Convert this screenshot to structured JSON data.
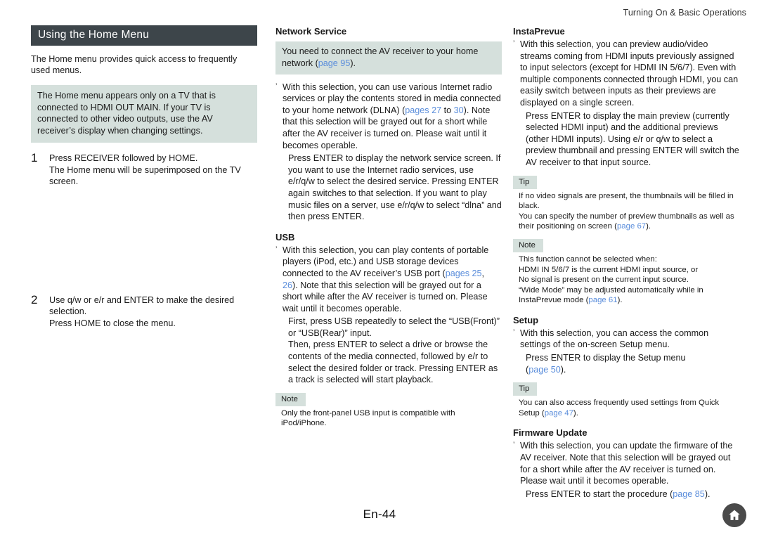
{
  "running_head": "Turning On & Basic Operations",
  "folio": "En-44",
  "home_button": {
    "icon": "home-icon"
  },
  "colors": {
    "title_bar_bg": "#3d454a",
    "callout_bg": "#d5e0dc",
    "link": "#5a8ddb",
    "text": "#1a1a1a",
    "home_button_bg": "#4a4a4a"
  },
  "left_column": {
    "title": "Using the Home Menu",
    "intro": "The Home menu provides quick access to frequently used menus.",
    "callout": "The Home menu appears only on a TV that is connected to HDMI OUT MAIN. If your TV is connected to other video outputs, use the AV receiver’s display when changing settings.",
    "steps": [
      {
        "number": "1",
        "body": "Press RECEIVER followed by HOME.",
        "sub": "The Home menu will be superimposed on the TV screen."
      },
      {
        "number": "2",
        "body": "Use q/w or e/r and ENTER to make the desired selection.",
        "sub": "Press HOME to close the menu."
      }
    ]
  },
  "middle_column": {
    "network_service": {
      "heading": "Network Service",
      "callout_pre": "You need to connect the AV receiver to your home network (",
      "callout_link": "page 95",
      "callout_post": ").",
      "bullet_1": "With this selection, you can use various Internet radio services or play the contents stored in media connected to your home network (DLNA) (",
      "bullet_1_link_a": "pages 27",
      "bullet_1_mid": " to ",
      "bullet_1_link_b": "30",
      "bullet_1_post": "). Note that this selection will be grayed out for a short while after the AV receiver is turned on. Please wait until it becomes operable.",
      "detail_1": "Press ENTER to display the network service screen. If you want to use the Internet radio services, use e/r/q/w to select the desired service. Pressing ENTER again switches to that selection. If you want to play music files on a server, use e/r/q/w to select “dlna” and then press ENTER."
    },
    "usb": {
      "heading": "USB",
      "bullet_1": "With this selection, you can play contents of portable players (iPod, etc.) and USB storage devices connected to the AV receiver’s USB port (",
      "bullet_1_link_a": "pages 25",
      "bullet_1_mid": ", ",
      "bullet_1_link_b": "26",
      "bullet_1_post": "). Note that this selection will be grayed out for a short while after the AV receiver is turned on. Please wait until it becomes operable.",
      "detail_1": "First, press USB repeatedly to select the “USB(Front)” or “USB(Rear)” input.",
      "detail_2": "Then, press ENTER to select a drive or browse the contents of the media connected, followed by e/r to select the desired folder or track. Pressing ENTER as a track is selected will start playback.",
      "note": {
        "tag": "Note",
        "lines": [
          "Only the front-panel USB input is compatible with iPod/iPhone."
        ]
      }
    }
  },
  "right_column": {
    "instaprevue": {
      "heading": "InstaPrevue",
      "bullet_1": "With this selection, you can preview audio/video streams coming from HDMI inputs previously assigned to input selectors (except for HDMI IN 5/6/7). Even with multiple components connected through HDMI, you can easily switch between inputs as their previews are displayed on a single screen.",
      "detail_1": "Press ENTER to display the main preview (currently selected HDMI input) and the additional previews (other HDMI inputs). Using e/r or q/w to select a preview thumbnail and pressing ENTER will switch the AV receiver to that input source.",
      "tip": {
        "tag": "Tip",
        "line_1": "If no video signals are present, the thumbnails will be filled in black.",
        "line_2_pre": "You can specify the number of preview thumbnails as well as their positioning on screen (",
        "line_2_link": "page 67",
        "line_2_post": ")."
      },
      "note": {
        "tag": "Note",
        "line_1": "This function cannot be selected when:",
        "line_2": "HDMI IN 5/6/7 is the current HDMI input source, or",
        "line_3": "No signal is present on the current input source.",
        "line_4_pre": "“Wide Mode” may be adjusted automatically while in InstaPrevue mode (",
        "line_4_link": "page 61",
        "line_4_post": ")."
      }
    },
    "setup": {
      "heading": "Setup",
      "bullet_1": "With this selection, you can access the common settings of the on-screen Setup menu.",
      "detail_1": "Press ENTER to display the Setup menu",
      "detail_2_pre": "(",
      "detail_2_link": "page 50",
      "detail_2_post": ").",
      "tip": {
        "tag": "Tip",
        "line_pre": "You can also access frequently used settings from Quick Setup (",
        "line_link": "page 47",
        "line_post": ")."
      }
    },
    "firmware_update": {
      "heading": "Firmware Update",
      "bullet_1": "With this selection, you can update the firmware of the AV receiver. Note that this selection will be grayed out for a short while after the AV receiver is turned on. Please wait until it becomes operable.",
      "detail_1_pre": "Press ENTER to start the procedure (",
      "detail_1_link": "page 85",
      "detail_1_post": ")."
    }
  }
}
